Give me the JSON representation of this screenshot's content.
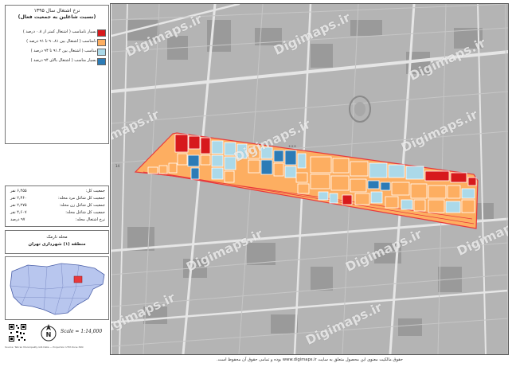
{
  "legend": {
    "title_line1": "نرخ اشتغال سال ۱۳۹۵",
    "title_line2": "(نسبت شاغلین به جمعیت فعال)",
    "items": [
      {
        "label": "بسیار نامناسب ( اشتغال کمتر از ۰.۸ درصد )",
        "color": "#d7191c"
      },
      {
        "label": "نامناسب ( اشتغال بین ۹۰.۸۱ تا ۹۱ درصد )",
        "color": "#fdae61"
      },
      {
        "label": "مناسب ( اشتغال بین ۹۱.۴ تا ۹۴ درصد )",
        "color": "#abd9e9"
      },
      {
        "label": "بسیار مناسب ( اشتغال بالای ۹۴ درصد )",
        "color": "#2c7bb6"
      }
    ]
  },
  "stats": [
    {
      "label": "جمعیت کل:",
      "value": "۶,۴۵۵ نفر"
    },
    {
      "label": "جمعیت کل شاغل مرد محله:",
      "value": "۲,۳۶۰ نفر"
    },
    {
      "label": "جمعیت کل شاغل زن محله:",
      "value": "۲,۲۷۵ نفر"
    },
    {
      "label": "جمعیت کل شاغل محله:",
      "value": "۴,۶۰۷ نفر"
    },
    {
      "label": "نرخ اشتغال محله:",
      "value": "۹۷ درصد"
    }
  ],
  "region": {
    "neighborhood": "محله نارمک",
    "district": "منطقه (۱) شهرداری تهران"
  },
  "scale_text": "Scale = 1:14,000",
  "north_letter": "N",
  "small_credit": "Source: Tehran Municipality GIS Data — Projection UTM Zone 39N",
  "watermark": "Digimaps.ir",
  "copyright": "حقوق مالکیت معنوی این محصول متعلق به سایت www.digimaps.ir بوده و تمامی حقوق آن محفوظ است.",
  "colors": {
    "very_poor": "#d7191c",
    "poor": "#fdae61",
    "good": "#abd9e9",
    "very_good": "#2c7bb6",
    "map_background": "#b4b4b4",
    "boundary": "#e8383c"
  }
}
